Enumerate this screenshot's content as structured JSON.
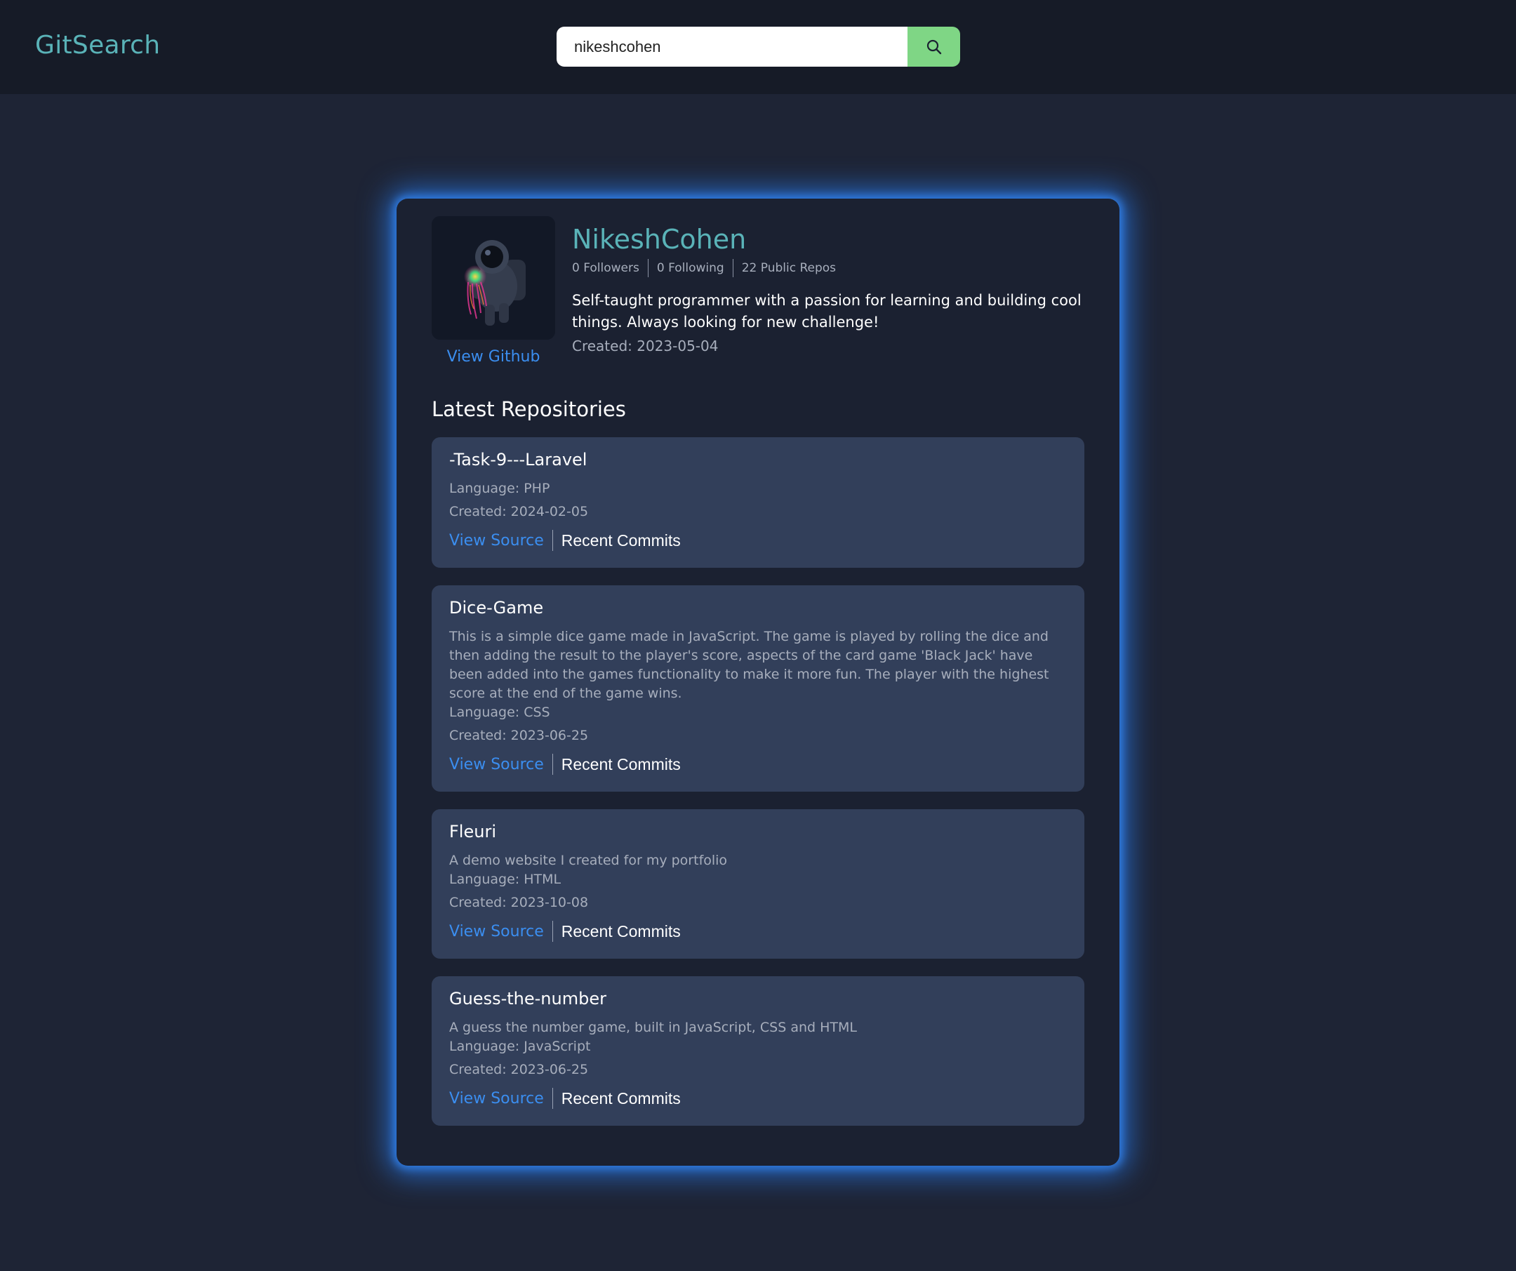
{
  "header": {
    "logo": "GitSearch",
    "search": {
      "value": "nikeshcohen",
      "placeholder": "",
      "button_icon": "search-icon"
    }
  },
  "profile": {
    "username": "NikeshCohen",
    "followers": "0 Followers",
    "following": "0 Following",
    "public_repos": "22 Public Repos",
    "bio": "Self-taught programmer with a passion for learning and building cool things. Always looking for new challenge!",
    "created": "Created: 2023-05-04",
    "view_github": "View Github",
    "avatar_icon": "astronaut-avatar"
  },
  "repos_section": {
    "title": "Latest Repositories",
    "items": [
      {
        "name": "-Task-9---Laravel",
        "description": "",
        "language": "Language: PHP",
        "created": "Created: 2024-02-05",
        "view_source": "View Source",
        "recent_commits": "Recent Commits"
      },
      {
        "name": "Dice-Game",
        "description": "This is a simple dice game made in JavaScript. The game is played by rolling the dice and then adding the result to the player's score, aspects of the card game 'Black Jack' have been added into the games functionality to make it more fun. The player with the highest score at the end of the game wins.",
        "language": "Language: CSS",
        "created": "Created: 2023-06-25",
        "view_source": "View Source",
        "recent_commits": "Recent Commits"
      },
      {
        "name": "Fleuri",
        "description": "A demo website I created for my portfolio",
        "language": "Language: HTML",
        "created": "Created: 2023-10-08",
        "view_source": "View Source",
        "recent_commits": "Recent Commits"
      },
      {
        "name": "Guess-the-number",
        "description": "A guess the number game, built in JavaScript, CSS and HTML",
        "language": "Language: JavaScript",
        "created": "Created: 2023-06-25",
        "view_source": "View Source",
        "recent_commits": "Recent Commits"
      }
    ]
  },
  "colors": {
    "accent_teal": "#5ab3b8",
    "link_blue": "#3b8ef0",
    "search_button_green": "#7fd685",
    "card_glow": "#2878e6"
  }
}
